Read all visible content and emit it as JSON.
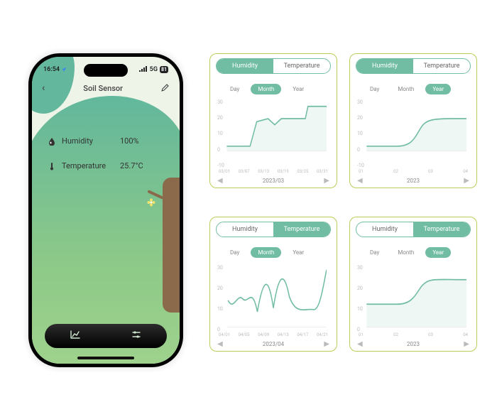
{
  "colors": {
    "primary": "#70bda3",
    "border": "#b8cf5a"
  },
  "phone": {
    "status": {
      "time": "16:54",
      "network": "5G",
      "battery": "81"
    },
    "header": {
      "title": "Soil Sensor"
    },
    "metrics": {
      "humidity_label": "Humidity",
      "humidity_value": "100%",
      "temperature_label": "Temperature",
      "temperature_value": "25.7°C"
    }
  },
  "common": {
    "tab_humidity": "Humidity",
    "tab_temperature": "Temperature",
    "range_day": "Day",
    "range_month": "Month",
    "range_year": "Year"
  },
  "cards": [
    {
      "active_tab": "humidity",
      "active_range": "month",
      "period": "2023/03",
      "xticks": [
        "03/01",
        "03/07",
        "03/13",
        "03/19",
        "03/25",
        "03/31"
      ]
    },
    {
      "active_tab": "humidity",
      "active_range": "year",
      "period": "2023",
      "xticks": [
        "01",
        "02",
        "03",
        "04"
      ]
    },
    {
      "active_tab": "temperature",
      "active_range": "month",
      "period": "2023/04",
      "xticks": [
        "04/01",
        "04/05",
        "04/09",
        "04/13",
        "04/17",
        "04/21"
      ]
    },
    {
      "active_tab": "temperature",
      "active_range": "year",
      "period": "2023",
      "xticks": [
        "01",
        "02",
        "03",
        "04"
      ]
    }
  ],
  "chart_data": [
    {
      "type": "line",
      "title": "Humidity — 2023/03",
      "xlabel": "",
      "ylabel": "",
      "ylim": [
        -10,
        30
      ],
      "yticks": [
        -10,
        0,
        10,
        20,
        30
      ],
      "x": [
        "03/01",
        "03/07",
        "03/13",
        "03/19",
        "03/25",
        "03/31"
      ],
      "values": [
        3,
        3,
        3,
        18,
        20,
        16,
        20,
        20,
        20,
        28,
        28
      ]
    },
    {
      "type": "line",
      "title": "Humidity — 2023",
      "xlabel": "",
      "ylabel": "",
      "ylim": [
        -10,
        30
      ],
      "yticks": [
        -10,
        0,
        10,
        20,
        30
      ],
      "x": [
        "01",
        "02",
        "03",
        "04"
      ],
      "values": [
        3,
        3,
        3,
        4,
        8,
        14,
        19,
        20,
        20,
        20
      ]
    },
    {
      "type": "line",
      "title": "Temperature — 2023/04",
      "xlabel": "",
      "ylabel": "",
      "ylim": [
        0,
        30
      ],
      "yticks": [
        0,
        10,
        20,
        30
      ],
      "x": [
        "04/01",
        "04/05",
        "04/09",
        "04/13",
        "04/17",
        "04/21"
      ],
      "values": [
        14,
        10,
        16,
        14,
        20,
        8,
        24,
        10,
        26,
        16,
        12,
        28
      ]
    },
    {
      "type": "line",
      "title": "Temperature — 2023",
      "xlabel": "",
      "ylabel": "",
      "ylim": [
        0,
        30
      ],
      "yticks": [
        0,
        10,
        20,
        30
      ],
      "x": [
        "01",
        "02",
        "03",
        "04"
      ],
      "values": [
        12,
        12,
        12,
        13,
        16,
        20,
        22,
        22,
        22,
        22
      ]
    }
  ]
}
